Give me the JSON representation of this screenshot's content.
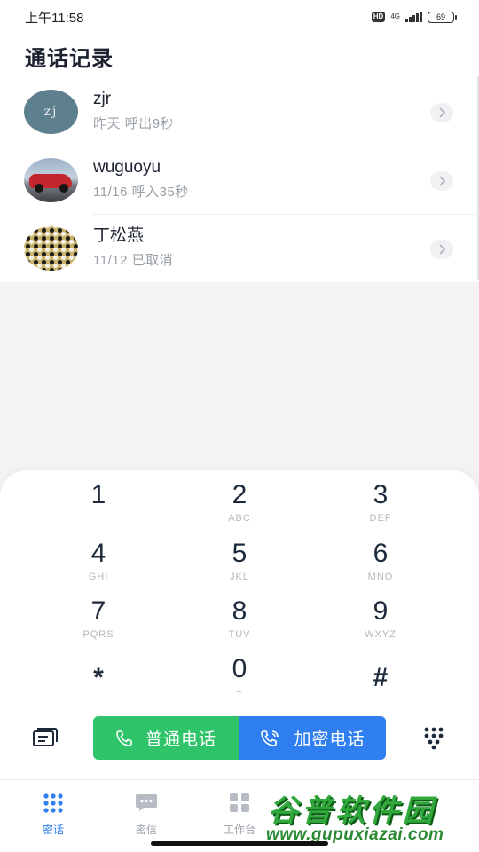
{
  "status_bar": {
    "time": "上午11:58",
    "hd": "HD",
    "network": "4G",
    "network_sub": "4G",
    "battery": "69"
  },
  "page": {
    "title": "通话记录"
  },
  "calls": [
    {
      "name": "zjr",
      "avatar_text": "zj",
      "date": "昨天",
      "detail": "呼出9秒",
      "avatar": "initials"
    },
    {
      "name": "wuguoyu",
      "avatar_text": "",
      "date": "11/16",
      "detail": "呼入35秒",
      "avatar": "red-car-photo"
    },
    {
      "name": "丁松燕",
      "avatar_text": "",
      "date": "11/12",
      "detail": "已取消",
      "avatar": "go-board-photo"
    }
  ],
  "keypad": {
    "keys": [
      {
        "digit": "1",
        "letters": ""
      },
      {
        "digit": "2",
        "letters": "ABC"
      },
      {
        "digit": "3",
        "letters": "DEF"
      },
      {
        "digit": "4",
        "letters": "GHI"
      },
      {
        "digit": "5",
        "letters": "JKL"
      },
      {
        "digit": "6",
        "letters": "MNO"
      },
      {
        "digit": "7",
        "letters": "PQRS"
      },
      {
        "digit": "8",
        "letters": "TUV"
      },
      {
        "digit": "9",
        "letters": "WXYZ"
      },
      {
        "digit": "*",
        "letters": ""
      },
      {
        "digit": "0",
        "letters": "+"
      },
      {
        "digit": "#",
        "letters": ""
      }
    ]
  },
  "actions": {
    "normal_call": "普通电话",
    "secure_call": "加密电话",
    "contacts_icon": "contacts-card-icon",
    "dialpad_icon": "dialpad-dots-icon"
  },
  "bottom_nav": {
    "items": [
      {
        "label": "密话",
        "icon": "dots-grid-icon",
        "active": true
      },
      {
        "label": "密信",
        "icon": "chat-bubble-icon",
        "active": false
      },
      {
        "label": "工作台",
        "icon": "apps-grid-icon",
        "active": false
      }
    ]
  },
  "watermark": {
    "title": "谷普软件园",
    "url": "www.gupuxiazai.com"
  },
  "colors": {
    "accent_blue": "#2f7ff0",
    "call_green": "#2fc46a",
    "text_dark": "#1c2230",
    "text_muted": "#9aa0a8"
  }
}
